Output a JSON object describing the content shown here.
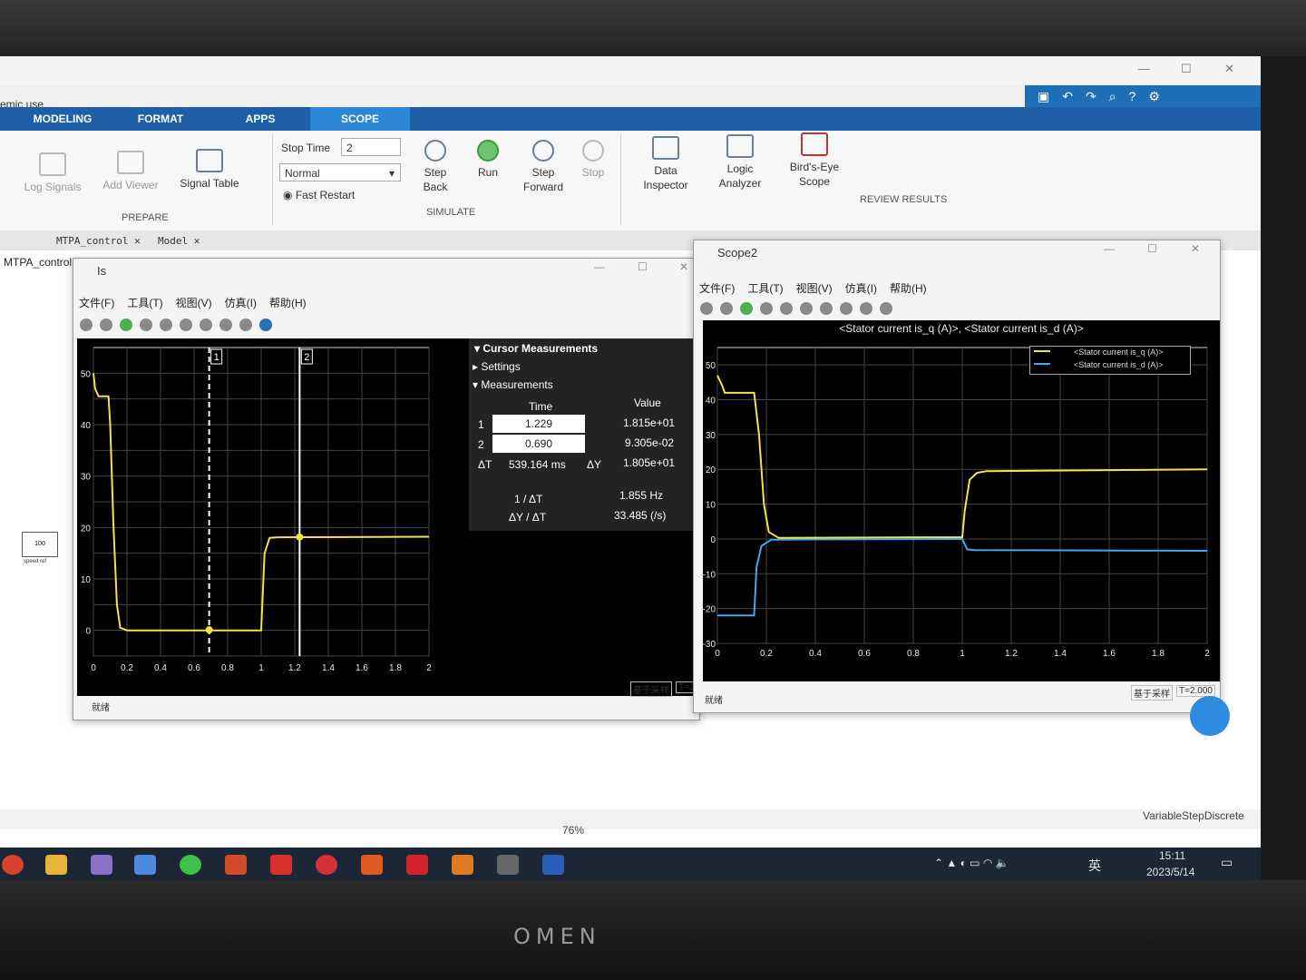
{
  "app": {
    "title_fragment": "emic use",
    "tabs": [
      "MODELING",
      "FORMAT",
      "APPS",
      "SCOPE"
    ],
    "active_tab": "SCOPE"
  },
  "ribbon": {
    "prepare": {
      "group_label": "PREPARE",
      "log_signals": "Log Signals",
      "add_viewer": "Add Viewer",
      "signal_table": "Signal Table"
    },
    "simulate": {
      "group_label": "SIMULATE",
      "stop_time_label": "Stop Time",
      "stop_time_value": "2",
      "mode_value": "Normal",
      "fast_restart": "Fast Restart",
      "step_back": "Step Back",
      "run": "Run",
      "step_forward": "Step Forward",
      "stop": "Stop"
    },
    "review": {
      "group_label": "REVIEW RESULTS",
      "data_inspector": "Data Inspector",
      "logic_analyzer": "Logic Analyzer",
      "birds_eye_scope": "Bird's-Eye Scope"
    }
  },
  "doc_tabs": [
    "MTPA_control",
    "Model"
  ],
  "breadcrumb": "MTPA_control",
  "model_block": {
    "value": "100",
    "label": "speed ref"
  },
  "scope1": {
    "title": "Is",
    "menu": [
      "文件(F)",
      "工具(T)",
      "视图(V)",
      "仿真(I)",
      "帮助(H)"
    ],
    "x_ticks": [
      "0",
      "0.2",
      "0.4",
      "0.6",
      "0.8",
      "1",
      "1.2",
      "1.4",
      "1.6",
      "1.8",
      "2"
    ],
    "y_ticks": [
      "50",
      "40",
      "30",
      "20",
      "10",
      "0"
    ],
    "cursor_labels": [
      "2",
      "1"
    ],
    "footer_left": "就绪",
    "footer_mid": "基于采样",
    "footer_right": "T=2.0",
    "trace_color": "#f2e34a"
  },
  "cursor_panel": {
    "title": "Cursor Measurements",
    "settings": "Settings",
    "measurements": "Measurements",
    "col_time": "Time",
    "col_value": "Value",
    "rows": [
      {
        "idx": "1",
        "time": "1.229",
        "value": "1.815e+01"
      },
      {
        "idx": "2",
        "time": "0.690",
        "value": "9.305e-02"
      }
    ],
    "dt_label": "ΔT",
    "dt_value": "539.164 ms",
    "dy_label": "ΔY",
    "dy_value": "1.805e+01",
    "inv_dt_label": "1 / ΔT",
    "inv_dt_value": "1.855 Hz",
    "dy_dt_label": "ΔY / ΔT",
    "dy_dt_value": "33.485 (/s)"
  },
  "scope2": {
    "title": "Scope2",
    "menu": [
      "文件(F)",
      "工具(T)",
      "视图(V)",
      "仿真(I)",
      "帮助(H)"
    ],
    "plot_title": "<Stator current is_q (A)>, <Stator current is_d (A)>",
    "legend": [
      "<Stator current is_q (A)>",
      "<Stator current is_d (A)>"
    ],
    "x_ticks": [
      "0",
      "0.2",
      "0.4",
      "0.6",
      "0.8",
      "1",
      "1.2",
      "1.4",
      "1.6",
      "1.8",
      "2"
    ],
    "y_ticks": [
      "50",
      "40",
      "30",
      "20",
      "10",
      "0",
      "-10",
      "-20",
      "-30"
    ],
    "footer_left": "就绪",
    "footer_mid": "基于采样",
    "footer_right": "T=2.000",
    "colors": {
      "q": "#f2e34a",
      "d": "#3fa9f5"
    }
  },
  "status": {
    "zoom": "76%",
    "solver": "VariableStepDiscrete"
  },
  "taskbar": {
    "time": "15:11",
    "date": "2023/5/14",
    "ime": "英"
  },
  "bezel_brand": "OMEN"
}
